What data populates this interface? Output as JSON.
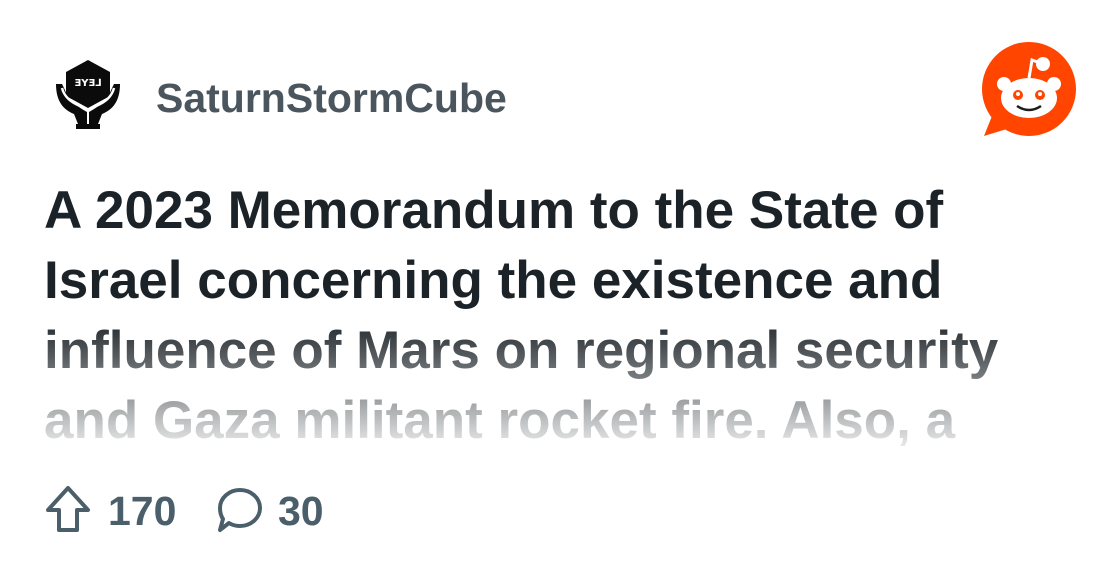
{
  "subreddit": {
    "name": "SaturnStormCube",
    "avatar_icon": "hands-holding-cube-icon",
    "avatar_lettering": "ƎYƎ⅃"
  },
  "brand": {
    "logo_icon": "reddit-snoo-icon",
    "accent_color": "#ff4500"
  },
  "post": {
    "title": "A 2023 Memorandum to the State of Israel concerning the existence and influence of Mars on regional security and Gaza militant rocket fire. Also, a"
  },
  "stats": {
    "upvotes": "170",
    "upvote_icon": "upvote-arrow-icon",
    "comments": "30",
    "comment_icon": "comment-bubble-icon"
  }
}
